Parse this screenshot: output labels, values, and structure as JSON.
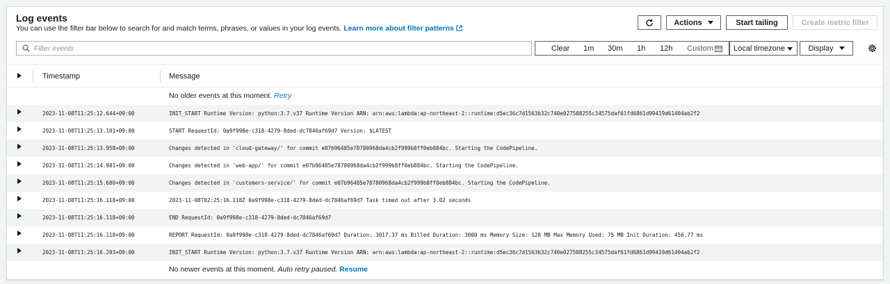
{
  "header": {
    "title": "Log events",
    "description": "You can use the filter bar below to search for and match terms, phrases, or values in your log events.",
    "learn_more_link": "Learn more about filter patterns"
  },
  "toolbar": {
    "actions_label": "Actions",
    "start_tailing_label": "Start tailing",
    "create_metric_filter_label": "Create metric filter",
    "refresh_icon": "refresh-icon"
  },
  "filter": {
    "placeholder": "Filter events",
    "value": ""
  },
  "time_range": {
    "clear": "Clear",
    "options": [
      "1m",
      "30m",
      "1h",
      "12h"
    ],
    "custom": "Custom"
  },
  "timezone": {
    "selected": "Local timezone"
  },
  "display": {
    "label": "Display"
  },
  "table": {
    "columns": [
      "Timestamp",
      "Message"
    ],
    "no_older": "No older events at this moment.",
    "retry_link": "Retry",
    "no_newer": "No newer events at this moment.",
    "auto_retry": "Auto retry paused.",
    "resume_link": "Resume",
    "rows": [
      {
        "timestamp": "2023-11-08T11:25:12.644+09:00",
        "message": "INIT_START Runtime Version: python:3.7.v37 Runtime Version ARN: arn:aws:lambda:ap-northeast-2::runtime:d5ec36c7d1563b32c740e027508255c34575daf61fd6861d99419d61404ab2f2"
      },
      {
        "timestamp": "2023-11-08T11:25:13.101+09:00",
        "message": "START RequestId: 0a9f998e-c318-4279-8ded-dc7846af69d7 Version: $LATEST"
      },
      {
        "timestamp": "2023-11-08T11:25:13.958+09:00",
        "message": "Changes detected in 'cloud-gateway/' for commit e07b96485e78780968da4cb2f999b8ff0eb884bc. Starting the CodePipeline."
      },
      {
        "timestamp": "2023-11-08T11:25:14.981+09:00",
        "message": "Changes detected in 'web-app/' for commit e07b96485e78780968da4cb2f999b8ff0eb884bc. Starting the CodePipeline."
      },
      {
        "timestamp": "2023-11-08T11:25:15.680+09:00",
        "message": "Changes detected in 'customers-service/' for commit e07b96485e78780968da4cb2f999b8ff0eb884bc. Starting the CodePipeline."
      },
      {
        "timestamp": "2023-11-08T11:25:16.118+09:00",
        "message": "2023-11-08T02:25:16.118Z 0a9f998e-c318-4279-8ded-dc7846af69d7 Task timed out after 3.02 seconds"
      },
      {
        "timestamp": "2023-11-08T11:25:16.118+09:00",
        "message": "END RequestId: 0a9f998e-c318-4279-8ded-dc7846af69d7"
      },
      {
        "timestamp": "2023-11-08T11:25:16.118+09:00",
        "message": "REPORT RequestId: 0a9f998e-c318-4279-8ded-dc7846af69d7 Duration: 3017.37 ms Billed Duration: 3000 ms Memory Size: 128 MB Max Memory Used: 75 MB Init Duration: 456.77 ms"
      },
      {
        "timestamp": "2023-11-08T11:25:16.203+09:00",
        "message": "INIT_START Runtime Version: python:3.7.v37 Runtime Version ARN: arn:aws:lambda:ap-northeast-2::runtime:d5ec36c7d1563b32c740e027508255c34575daf61fd6861d99419d61404ab2f2"
      }
    ]
  },
  "colors": {
    "link": "#0073bb",
    "text": "#16191f",
    "border": "#545b64",
    "row_alt": "#f2f3f3"
  }
}
